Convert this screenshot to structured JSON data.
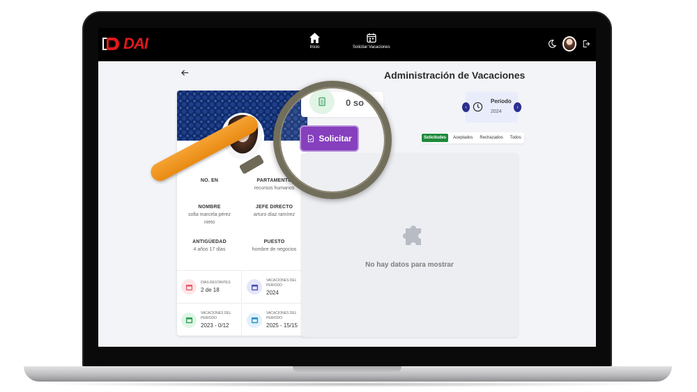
{
  "topbar": {
    "logo_text": "DAI",
    "nav": [
      {
        "label": "Inicio",
        "icon": "home-icon"
      },
      {
        "label": "Solicitar Vacaciones",
        "icon": "calendar-icon"
      }
    ],
    "right_icons": [
      "moon-icon",
      "avatar",
      "logout-icon"
    ]
  },
  "page": {
    "title": "Administración de Vacaciones"
  },
  "profile": {
    "fields": [
      {
        "label": "NO. EN",
        "value": ""
      },
      {
        "label": "PARTAMENTO",
        "value": "recursos humanos"
      },
      {
        "label": "NOMBRE",
        "value": "sofia marcela pérez nieto"
      },
      {
        "label": "JEFE DIRECTO",
        "value": "arturo díaz ramírez"
      },
      {
        "label": "ANTIGÜEDAD",
        "value": "4 años 17 días"
      },
      {
        "label": "PUESTO",
        "value": "hombre de negocios"
      }
    ],
    "stats": [
      {
        "label": "DÍAS RESTANTES",
        "value": "2 de 18",
        "color": "#e85b6b",
        "bg": "#fde6e8"
      },
      {
        "label": "VACACIONES DEL PERIODO",
        "value": "2024",
        "color": "#4b4fb3",
        "bg": "#e5e6fa"
      },
      {
        "label": "VACACIONES DEL PERIODO",
        "value": "2023 - 0/12",
        "color": "#2f9e52",
        "bg": "#e0f5e6"
      },
      {
        "label": "VACACIONES DEL PERIODO",
        "value": "2025 - 15/15",
        "color": "#2a8ec9",
        "bg": "#e1f1fb"
      }
    ]
  },
  "summary": {
    "text": "0 so"
  },
  "solicitar_label": "Solicitar",
  "period": {
    "title": "Periodo",
    "year": "2024"
  },
  "tabs": [
    {
      "label": "Solicitudes",
      "active": true
    },
    {
      "label": "Aceptados",
      "active": false
    },
    {
      "label": "Rechazados",
      "active": false
    },
    {
      "label": "Todos",
      "active": false
    }
  ],
  "empty_state": {
    "text": "No hay datos para mostrar",
    "icon": "puzzle-icon"
  },
  "colors": {
    "accent_purple": "#7c2fb8",
    "tab_green": "#1e8a3b",
    "period_blue": "#2b2f8f",
    "magnifier_handle": "#f39b22"
  }
}
